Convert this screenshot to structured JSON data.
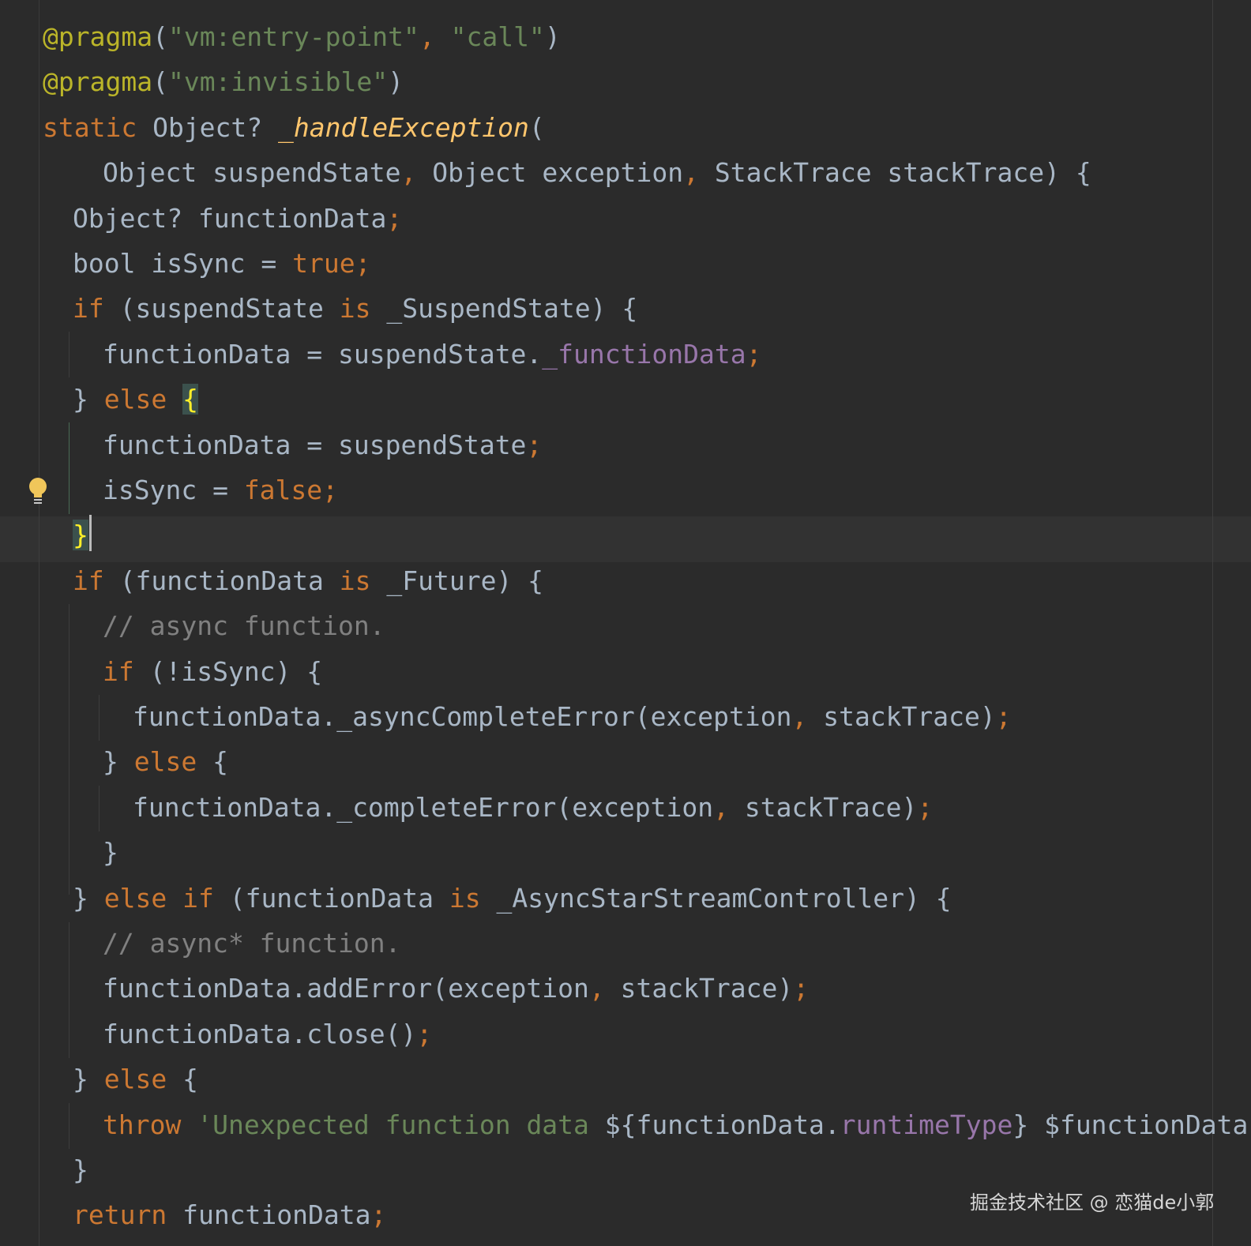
{
  "editor": {
    "watermark": "掘金技术社区 @ 恋猫de小郭",
    "lines": [
      {
        "indent": 0,
        "tokens": [
          [
            "@pragma",
            "pragma"
          ],
          [
            "(",
            "plain"
          ],
          [
            "\"vm:entry-point\"",
            "str"
          ],
          [
            ", ",
            "punct"
          ],
          [
            "\"call\"",
            "str"
          ],
          [
            ")",
            "plain"
          ]
        ]
      },
      {
        "indent": 0,
        "tokens": [
          [
            "@pragma",
            "pragma"
          ],
          [
            "(",
            "plain"
          ],
          [
            "\"vm:invisible\"",
            "str"
          ],
          [
            ")",
            "plain"
          ]
        ]
      },
      {
        "indent": 0,
        "tokens": [
          [
            "static ",
            "kw"
          ],
          [
            "Object? ",
            "plain"
          ],
          [
            "_handleException",
            "fn"
          ],
          [
            "(",
            "plain"
          ]
        ]
      },
      {
        "indent": 2,
        "tokens": [
          [
            "Object suspendState",
            "plain"
          ],
          [
            ", ",
            "punct"
          ],
          [
            "Object exception",
            "plain"
          ],
          [
            ", ",
            "punct"
          ],
          [
            "StackTrace stackTrace) {",
            "plain"
          ]
        ]
      },
      {
        "indent": 1,
        "tokens": [
          [
            "Object? functionData",
            "plain"
          ],
          [
            ";",
            "punct"
          ]
        ]
      },
      {
        "indent": 1,
        "tokens": [
          [
            "bool isSync = ",
            "plain"
          ],
          [
            "true",
            "kw"
          ],
          [
            ";",
            "punct"
          ]
        ]
      },
      {
        "indent": 1,
        "tokens": [
          [
            "if ",
            "kw"
          ],
          [
            "(suspendState ",
            "plain"
          ],
          [
            "is ",
            "kw"
          ],
          [
            "_SuspendState) {",
            "plain"
          ]
        ]
      },
      {
        "indent": 2,
        "tokens": [
          [
            "functionData = suspendState.",
            "plain"
          ],
          [
            "_functionData",
            "field"
          ],
          [
            ";",
            "punct"
          ]
        ]
      },
      {
        "indent": 1,
        "tokens": [
          [
            "} ",
            "plain"
          ],
          [
            "else ",
            "kw"
          ],
          [
            "{",
            "brace-hl"
          ]
        ]
      },
      {
        "indent": 2,
        "tokens": [
          [
            "functionData = suspendState",
            "plain"
          ],
          [
            ";",
            "punct"
          ]
        ]
      },
      {
        "indent": 2,
        "tokens": [
          [
            "isSync = ",
            "plain"
          ],
          [
            "false",
            "kw"
          ],
          [
            ";",
            "punct"
          ]
        ]
      },
      {
        "indent": 1,
        "caret": true,
        "tokens": [
          [
            "}",
            "brace-hl"
          ]
        ]
      },
      {
        "indent": 1,
        "tokens": [
          [
            "if ",
            "kw"
          ],
          [
            "(functionData ",
            "plain"
          ],
          [
            "is ",
            "kw"
          ],
          [
            "_Future) {",
            "plain"
          ]
        ]
      },
      {
        "indent": 2,
        "tokens": [
          [
            "// async function.",
            "comment"
          ]
        ]
      },
      {
        "indent": 2,
        "tokens": [
          [
            "if ",
            "kw"
          ],
          [
            "(!isSync) {",
            "plain"
          ]
        ]
      },
      {
        "indent": 3,
        "tokens": [
          [
            "functionData._asyncCompleteError(exception",
            "plain"
          ],
          [
            ", ",
            "punct"
          ],
          [
            "stackTrace)",
            "plain"
          ],
          [
            ";",
            "punct"
          ]
        ]
      },
      {
        "indent": 2,
        "tokens": [
          [
            "} ",
            "plain"
          ],
          [
            "else ",
            "kw"
          ],
          [
            "{",
            "plain"
          ]
        ]
      },
      {
        "indent": 3,
        "tokens": [
          [
            "functionData._completeError(exception",
            "plain"
          ],
          [
            ", ",
            "punct"
          ],
          [
            "stackTrace)",
            "plain"
          ],
          [
            ";",
            "punct"
          ]
        ]
      },
      {
        "indent": 2,
        "tokens": [
          [
            "}",
            "plain"
          ]
        ]
      },
      {
        "indent": 1,
        "tokens": [
          [
            "} ",
            "plain"
          ],
          [
            "else if ",
            "kw"
          ],
          [
            "(functionData ",
            "plain"
          ],
          [
            "is ",
            "kw"
          ],
          [
            "_AsyncStarStreamController) {",
            "plain"
          ]
        ]
      },
      {
        "indent": 2,
        "tokens": [
          [
            "// async* function.",
            "comment"
          ]
        ]
      },
      {
        "indent": 2,
        "tokens": [
          [
            "functionData.addError(exception",
            "plain"
          ],
          [
            ", ",
            "punct"
          ],
          [
            "stackTrace)",
            "plain"
          ],
          [
            ";",
            "punct"
          ]
        ]
      },
      {
        "indent": 2,
        "tokens": [
          [
            "functionData.close()",
            "plain"
          ],
          [
            ";",
            "punct"
          ]
        ]
      },
      {
        "indent": 1,
        "tokens": [
          [
            "} ",
            "plain"
          ],
          [
            "else ",
            "kw"
          ],
          [
            "{",
            "plain"
          ]
        ]
      },
      {
        "indent": 2,
        "tokens": [
          [
            "throw ",
            "kw"
          ],
          [
            "'Unexpected function data ",
            "str"
          ],
          [
            "${functionData.",
            "plain"
          ],
          [
            "runtimeType",
            "field"
          ],
          [
            "} $functionData",
            "plain"
          ],
          [
            "'",
            "str"
          ],
          [
            ";",
            "punct"
          ]
        ]
      },
      {
        "indent": 1,
        "tokens": [
          [
            "}",
            "plain"
          ]
        ]
      },
      {
        "indent": 1,
        "tokens": [
          [
            "return ",
            "kw"
          ],
          [
            "functionData",
            "plain"
          ],
          [
            ";",
            "punct"
          ]
        ]
      }
    ]
  }
}
